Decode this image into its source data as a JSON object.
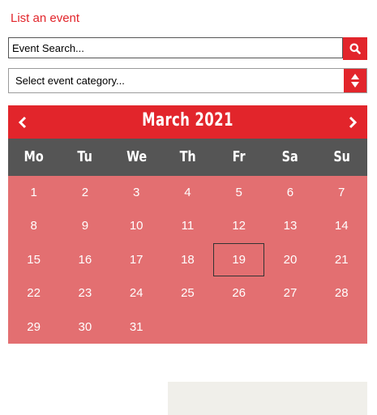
{
  "list_link": "List an event",
  "search": {
    "placeholder": "Event Search..."
  },
  "category_select": {
    "value": "Select event category..."
  },
  "calendar": {
    "month_title": "March 2021",
    "weekdays": [
      "Mo",
      "Tu",
      "We",
      "Th",
      "Fr",
      "Sa",
      "Su"
    ],
    "weeks": [
      [
        "1",
        "2",
        "3",
        "4",
        "5",
        "6",
        "7"
      ],
      [
        "8",
        "9",
        "10",
        "11",
        "12",
        "13",
        "14"
      ],
      [
        "15",
        "16",
        "17",
        "18",
        "19",
        "20",
        "21"
      ],
      [
        "22",
        "23",
        "24",
        "25",
        "26",
        "27",
        "28"
      ],
      [
        "29",
        "30",
        "31"
      ]
    ],
    "selected_day": "19"
  },
  "colors": {
    "accent": "#e2252b",
    "header_dark": "#555555",
    "day_cell": "#e36f71",
    "empty_cell": "#f0efea"
  },
  "icons": {
    "search": "search-icon",
    "prev": "chevron-left-icon",
    "next": "chevron-right-icon",
    "select": "select-arrows-icon"
  }
}
